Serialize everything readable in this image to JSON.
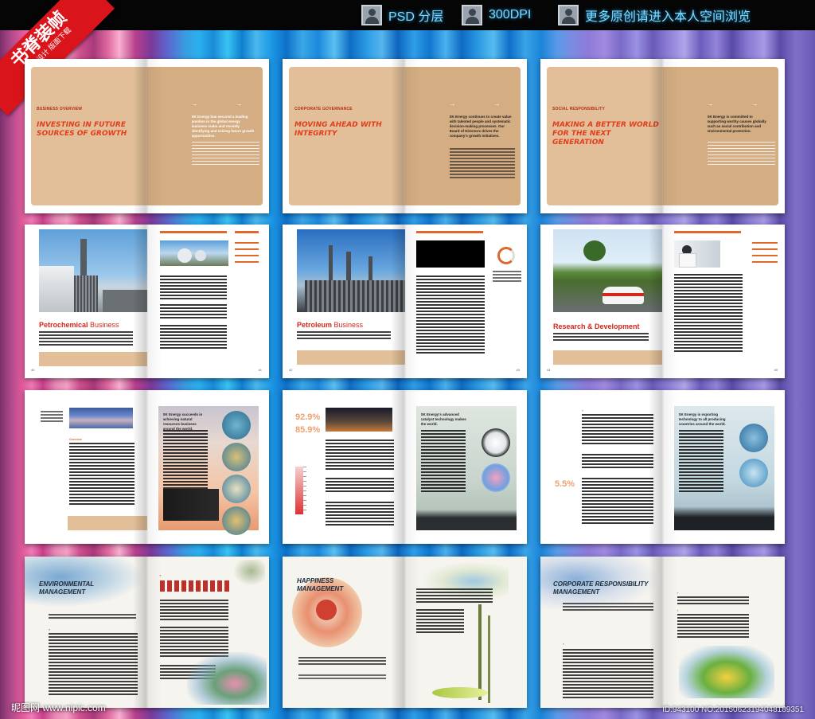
{
  "topbar": {
    "items": [
      {
        "label": "PSD 分层"
      },
      {
        "label": "300DPI"
      },
      {
        "label": "更多原创请进入本人空间浏览"
      }
    ]
  },
  "ribbon": {
    "title": "书脊装帧",
    "subtitle": "画册设计 版面下载"
  },
  "row1": [
    {
      "kicker": "BUSINESS OVERVIEW",
      "headline": "INVESTING IN FUTURE\nSOURCES OF GROWTH",
      "lead": "SK Energy has secured a leading position in the global energy business realm and recently identifying and seizing future growth opportunities."
    },
    {
      "kicker": "CORPORATE GOVERNANCE",
      "headline": "MOVING AHEAD WITH\nINTEGRITY",
      "lead": "SK Energy continues to create value with talented people and systematic decision-making processes. Our Board of Directors drives the company's growth initiatives."
    },
    {
      "kicker": "SOCIAL RESPONSIBILITY",
      "headline": "MAKING A BETTER WORLD\nFOR THE NEXT GENERATION",
      "lead": "SK Energy is committed to supporting worthy causes globally such as social contribution and environmental protection."
    }
  ],
  "row2": [
    {
      "title_main": "Petrochemical",
      "title_rest": " Business"
    },
    {
      "title_main": "Petroleum",
      "title_rest": " Business"
    },
    {
      "title_main": "Research & Development",
      "title_rest": ""
    }
  ],
  "row3": [
    {
      "lead": "SK Energy succeeds in achieving natural resources business around the world."
    },
    {
      "pct1": "92.9%",
      "pct2": "85.9%",
      "lead": "SK Energy's advanced catalyst technology makes the world."
    },
    {
      "pct1": "5.5%",
      "lead": "SK Energy is exporting technology to all producing countries around the world."
    }
  ],
  "row4": [
    {
      "headline": "ENVIRONMENTAL\nMANAGEMENT"
    },
    {
      "headline": "HAPPINESS\nMANAGEMENT"
    },
    {
      "headline": "CORPORATE RESPONSIBILITY\nMANAGEMENT"
    }
  ],
  "watermark": {
    "left": "昵图网 www.nipic.com",
    "right": "ID:943100 NO:20150623194048189351"
  },
  "colors": {
    "accent_red": "#d4261a",
    "tan": "#e2bf98",
    "orange": "#e0662a"
  }
}
